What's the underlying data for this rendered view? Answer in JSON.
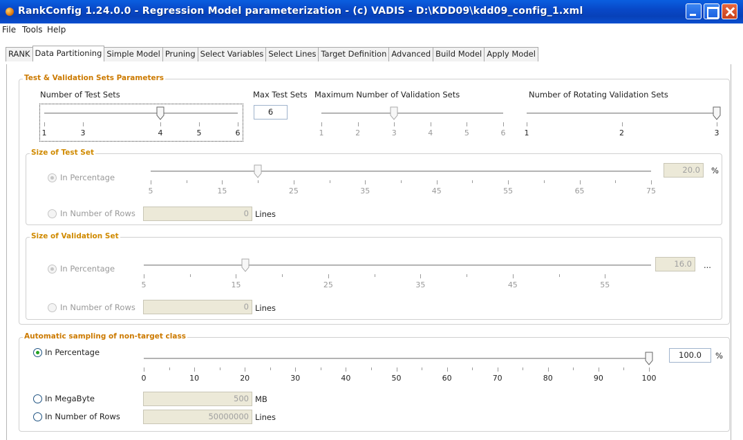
{
  "window": {
    "title": "RankConfig 1.24.0.0 - Regression Model parameterization - (c) VADIS  - D:\\KDD09\\kdd09_config_1.xml"
  },
  "menu": [
    "File",
    "Tools",
    "Help"
  ],
  "tabs": [
    "RANK",
    "Data Partitioning",
    "Simple Model",
    "Pruning",
    "Select Variables",
    "Select Lines",
    "Target Definition",
    "Advanced",
    "Build Model",
    "Apply Model"
  ],
  "active_tab": "Data Partitioning",
  "test_validation": {
    "legend": "Test & Validation Sets Parameters",
    "num_test_sets_label": "Number of Test Sets",
    "num_test_sets_ticks": [
      "1",
      "3",
      "4",
      "5",
      "6"
    ],
    "num_test_sets_value": 4,
    "max_test_sets_label": "Max Test Sets",
    "max_test_sets_value": "6",
    "max_validation_label": "Maximum Number of Validation Sets",
    "max_validation_ticks": [
      "1",
      "2",
      "3",
      "4",
      "5",
      "6"
    ],
    "max_validation_value": 3,
    "rotating_label": "Number of Rotating Validation Sets",
    "rotating_ticks": [
      "1",
      "2",
      "3"
    ],
    "rotating_value": 3
  },
  "size_test_set": {
    "legend": "Size of Test Set",
    "pct_label": "In Percentage",
    "rows_label": "In Number of Rows",
    "ticks": [
      "5",
      "15",
      "25",
      "35",
      "45",
      "55",
      "65",
      "75"
    ],
    "slider_value": 20,
    "pct_value": "20.0",
    "pct_unit": "%",
    "rows_value": "0",
    "rows_unit": "Lines"
  },
  "size_validation_set": {
    "legend": "Size of Validation Set",
    "pct_label": "In Percentage",
    "rows_label": "In Number of Rows",
    "ticks": [
      "5",
      "15",
      "25",
      "35",
      "45",
      "55"
    ],
    "slider_value": 16,
    "pct_value": "16.0",
    "pct_unit": "...",
    "rows_value": "0",
    "rows_unit": "Lines"
  },
  "sampling": {
    "legend": "Automatic sampling of non-target class",
    "pct_label": "In Percentage",
    "mb_label": "In MegaByte",
    "rows_label": "In Number of Rows",
    "ticks": [
      "0",
      "10",
      "20",
      "30",
      "40",
      "50",
      "60",
      "70",
      "80",
      "90",
      "100"
    ],
    "slider_value": 100,
    "pct_value": "100.0",
    "pct_unit": "%",
    "mb_value": "500",
    "mb_unit": "MB",
    "rows_value": "50000000",
    "rows_unit": "Lines"
  }
}
